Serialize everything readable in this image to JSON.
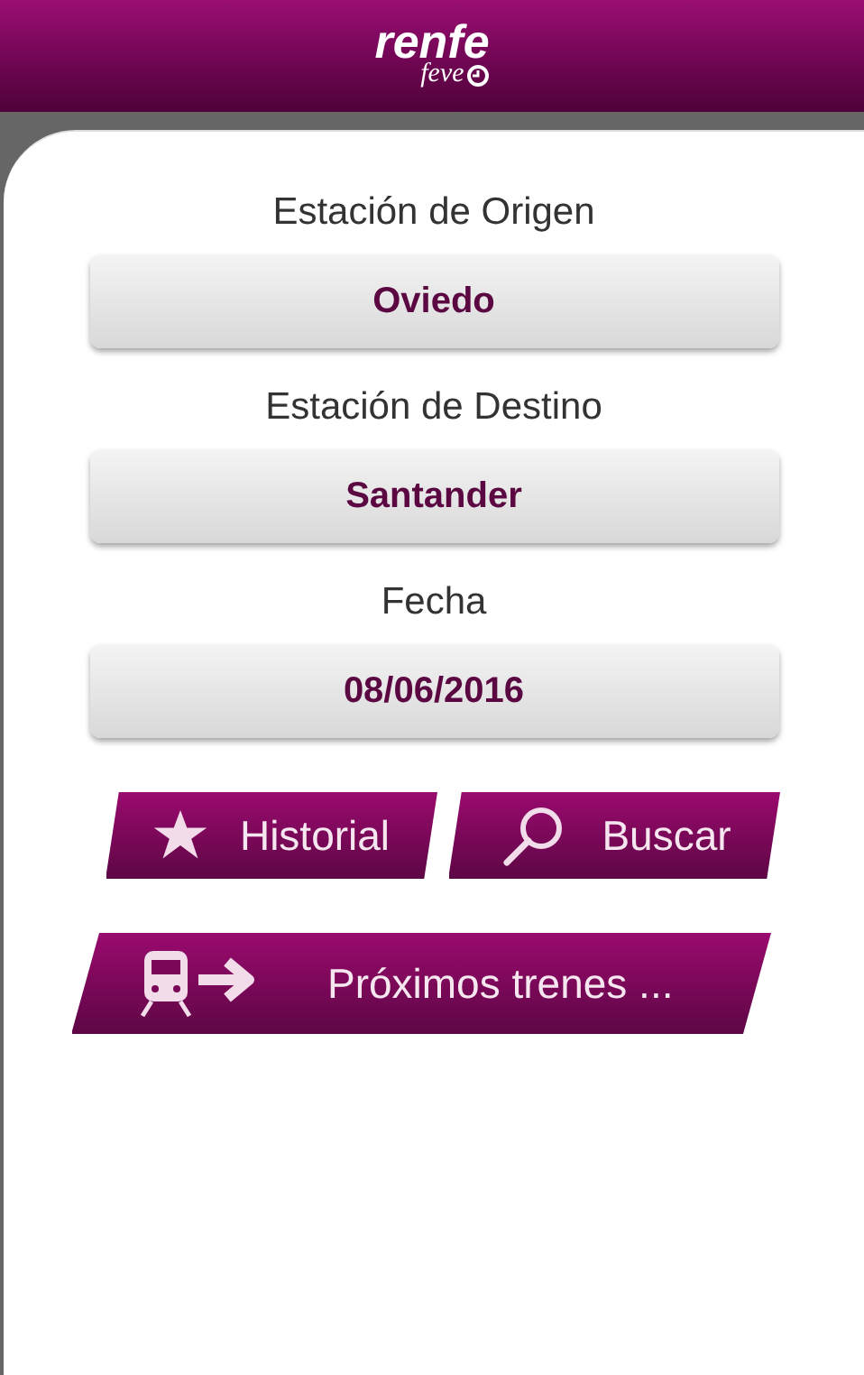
{
  "logo": {
    "brand": "renfe",
    "sub": "feve"
  },
  "fields": [
    {
      "label": "Estación de Origen",
      "value": "Oviedo"
    },
    {
      "label": "Estación de Destino",
      "value": "Santander"
    },
    {
      "label": "Fecha",
      "value": "08/06/2016"
    }
  ],
  "actions": [
    {
      "kind": "history",
      "label": "Historial"
    },
    {
      "kind": "search",
      "label": "Buscar"
    }
  ],
  "next_trains": {
    "label": "Próximos trenes ..."
  }
}
